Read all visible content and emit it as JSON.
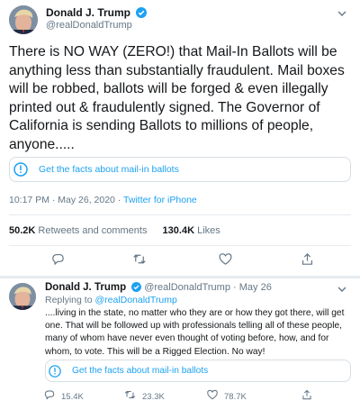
{
  "main_tweet": {
    "author_name": "Donald J. Trump",
    "author_handle": "@realDonaldTrump",
    "text_lines": [
      "There is NO WAY (ZERO!) that Mail-In Ballots will be",
      "anything less than substantially fraudulent. Mail boxes",
      "will be robbed, ballots will be forged & even illegally",
      "printed out & fraudulently signed. The Governor of",
      "California is sending Ballots to millions of people,",
      "anyone....."
    ],
    "facts_label": "Get the facts about mail-in ballots",
    "time": "10:17 PM · May 26, 2020 · ",
    "source": "Twitter for iPhone",
    "retweets_count": "50.2K",
    "retweets_label": "Retweets and comments",
    "likes_count": "130.4K",
    "likes_label": "Likes"
  },
  "reply_tweet": {
    "author_name": "Donald J. Trump",
    "author_handle": "@realDonaldTrump",
    "date": "May 26",
    "separator": "·",
    "replying_prefix": "Replying to ",
    "replying_handle": "@realDonaldTrump",
    "text_lines": [
      "....living in the state, no matter who they are or how they got there, will get",
      "one. That will be followed up with professionals telling all of these people,",
      "many of whom have never even thought of voting before, how, and for",
      "whom, to vote. This will be a Rigged Election. No way!"
    ],
    "facts_label": "Get the facts about mail-in ballots",
    "reply_count": "15.4K",
    "retweet_count": "23.3K",
    "like_count": "78.7K"
  },
  "icons": {
    "verified": "verified-badge-icon",
    "chevron": "chevron-down-icon",
    "info": "info-circle-icon",
    "reply": "reply-icon",
    "retweet": "retweet-icon",
    "like": "heart-icon",
    "share": "share-icon"
  },
  "colors": {
    "accent": "#1da1f2",
    "text": "#14171a",
    "secondary": "#657786",
    "divider": "#e6ecf0"
  }
}
